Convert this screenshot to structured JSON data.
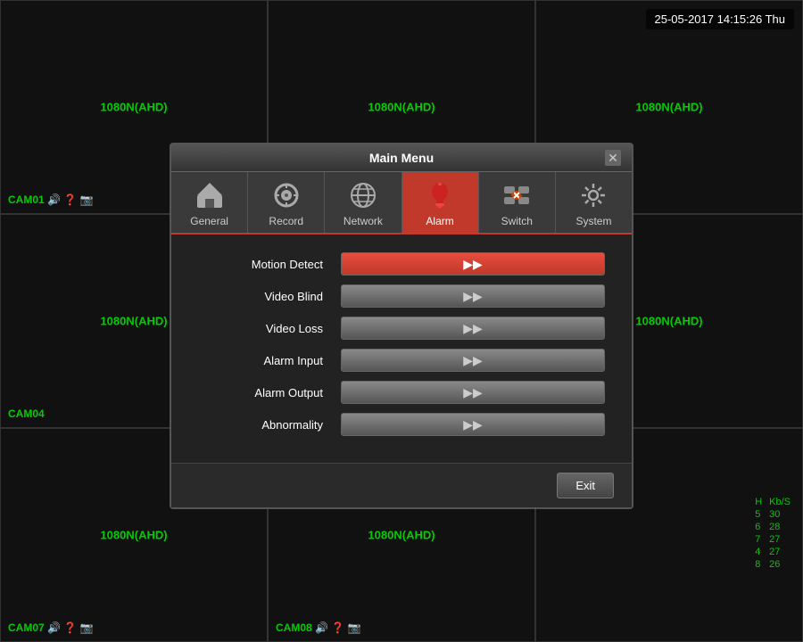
{
  "datetime": "25-05-2017 14:15:26 Thu",
  "cameras": [
    {
      "id": "cam1",
      "resolution": "1080N(AHD)",
      "label": null,
      "position": "top-left"
    },
    {
      "id": "cam2",
      "resolution": "1080N(AHD)",
      "label": null,
      "position": "top-center"
    },
    {
      "id": "cam3",
      "resolution": "1080N(AHD)",
      "label": null,
      "position": "top-right"
    },
    {
      "id": "cam4",
      "label": "CAM04",
      "resolution": "1080N(AHD)",
      "position": "mid-left"
    },
    {
      "id": "cam5",
      "resolution": "",
      "label": null,
      "position": "mid-center"
    },
    {
      "id": "cam6",
      "resolution": "1080N(AHD)",
      "label": null,
      "position": "mid-right"
    },
    {
      "id": "cam7",
      "label": "CAM07",
      "resolution": "1080N(AHD)",
      "position": "bot-left"
    },
    {
      "id": "cam8",
      "label": "CAM08",
      "resolution": "1080N(AHD)",
      "position": "bot-center"
    },
    {
      "id": "cam9",
      "resolution": "",
      "label": null,
      "position": "bot-right"
    }
  ],
  "cam1_label": "CAM01",
  "stats": {
    "header": [
      "H",
      "Kb/S"
    ],
    "rows": [
      [
        "5",
        "30"
      ],
      [
        "6",
        "28"
      ],
      [
        "7",
        "27"
      ],
      [
        "4",
        "27"
      ],
      [
        "8",
        "26"
      ]
    ]
  },
  "main_menu": {
    "title": "Main Menu",
    "close_label": "✕",
    "tabs": [
      {
        "id": "general",
        "label": "General",
        "icon": "🏠",
        "active": false
      },
      {
        "id": "record",
        "label": "Record",
        "icon": "⚙",
        "active": false
      },
      {
        "id": "network",
        "label": "Network",
        "icon": "🌐",
        "active": false
      },
      {
        "id": "alarm",
        "label": "Alarm",
        "icon": "🚨",
        "active": true
      },
      {
        "id": "switch",
        "label": "Switch",
        "icon": "🔄",
        "active": false
      },
      {
        "id": "system",
        "label": "System",
        "icon": "⚙",
        "active": false
      }
    ],
    "menu_items": [
      {
        "label": "Motion Detect",
        "highlighted": true
      },
      {
        "label": "Video Blind",
        "highlighted": false
      },
      {
        "label": "Video Loss",
        "highlighted": false
      },
      {
        "label": "Alarm Input",
        "highlighted": false
      },
      {
        "label": "Alarm Output",
        "highlighted": false
      },
      {
        "label": "Abnormality",
        "highlighted": false
      }
    ],
    "exit_label": "Exit"
  }
}
